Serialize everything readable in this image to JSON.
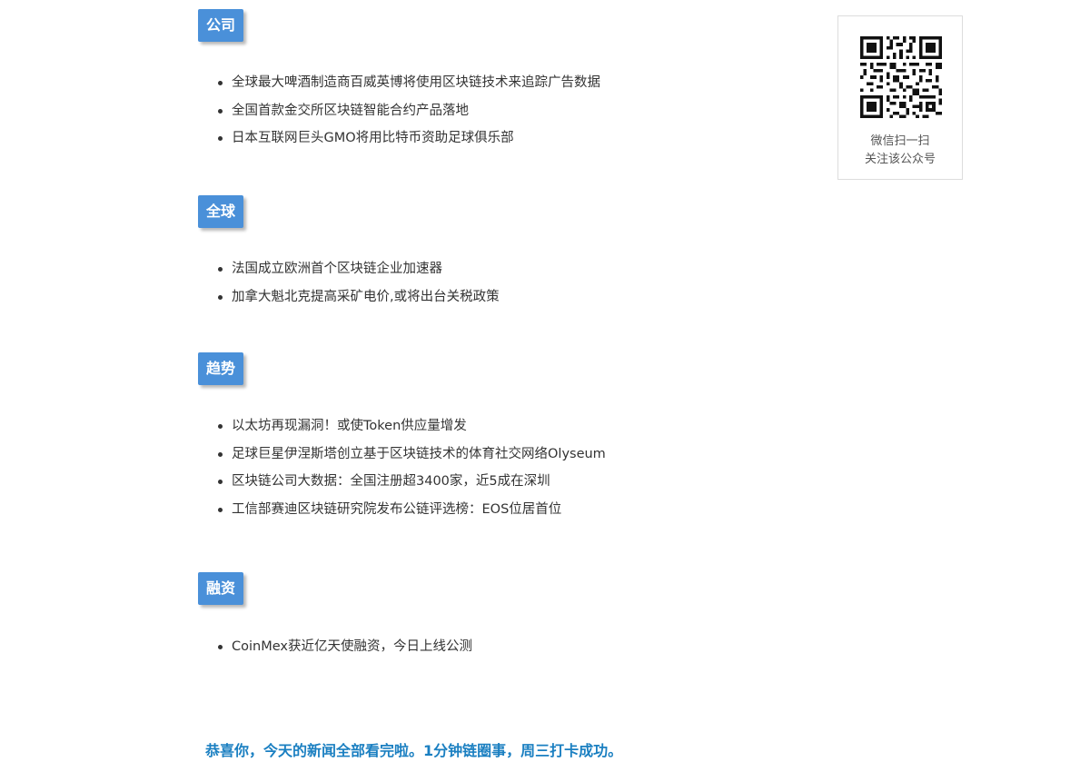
{
  "sections": [
    {
      "tag": "公司",
      "items": [
        "全球最大啤酒制造商百威英博将使用区块链技术来追踪广告数据",
        "全国首款金交所区块链智能合约产品落地",
        "日本互联网巨头GMO将用比特币资助足球俱乐部"
      ]
    },
    {
      "tag": "全球",
      "items": [
        "法国成立欧洲首个区块链企业加速器",
        "加拿大魁北克提高采矿电价,或将出台关税政策"
      ]
    },
    {
      "tag": "趋势",
      "items": [
        "以太坊再现漏洞！或使Token供应量增发",
        "足球巨星伊涅斯塔创立基于区块链技术的体育社交网络Olyseum",
        "区块链公司大数据：全国注册超3400家，近5成在深圳",
        "工信部赛迪区块链研究院发布公链评选榜：EOS位居首位"
      ]
    },
    {
      "tag": "融资",
      "items": [
        "CoinMex获近亿天使融资，今日上线公测"
      ]
    }
  ],
  "qr": {
    "icon": "qr-code-icon",
    "caption_line1": "微信扫一扫",
    "caption_line2": "关注该公众号"
  },
  "footer": {
    "text": "恭喜你，今天的新闻全部看完啦。1分钟链圈事，周三打卡成功。"
  },
  "colors": {
    "tag_background": "#4a90d9",
    "footer_text": "#1a7fc1",
    "body_text": "#333333"
  }
}
